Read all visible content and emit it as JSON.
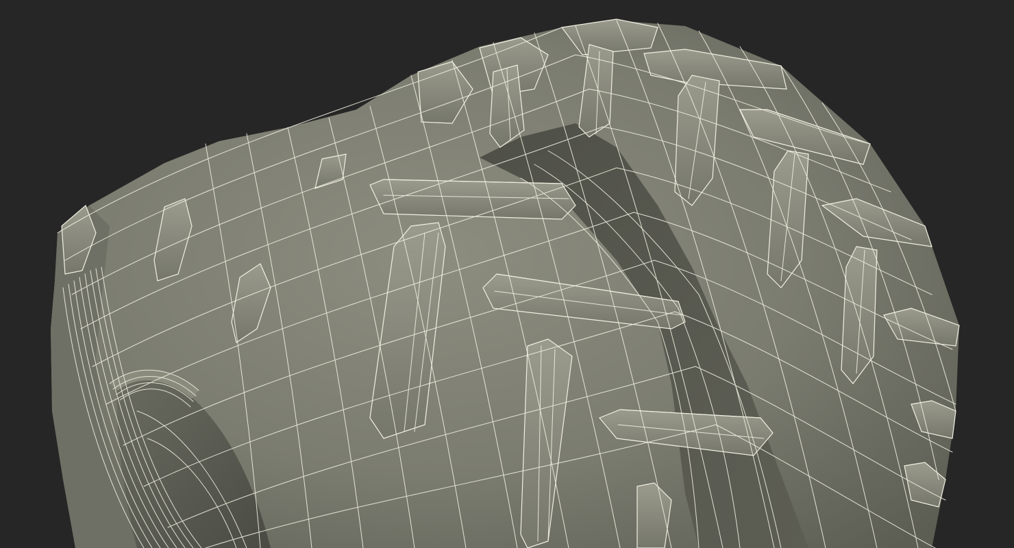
{
  "scene": {
    "subject": "tire-wireframe-render",
    "background_color": "#262626",
    "tire_fill_color": "#7b7c70",
    "tire_shadow_color": "#4d4e45",
    "tire_highlight_color": "#9a9b8d",
    "wire_color": "#f1f0e2"
  }
}
